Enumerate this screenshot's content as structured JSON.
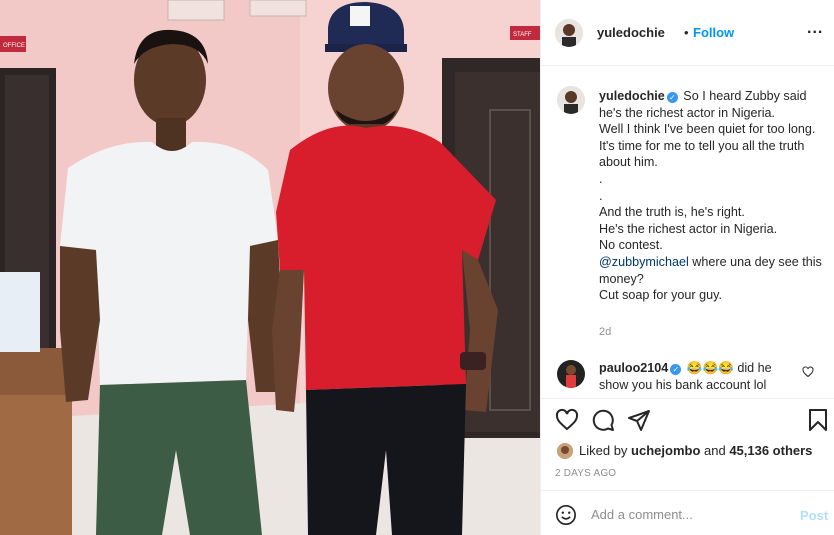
{
  "post": {
    "username": "yuledochie",
    "follow_label": "Follow",
    "dot": "•",
    "more": "...",
    "caption_lines": [
      "So I heard Zubby said he's the richest actor in Nigeria.",
      "Well I think I've been quiet for too long.",
      "It's time for me to tell you all the truth about him.",
      ".",
      ".",
      "And the truth is, he's right.",
      "He's the richest actor in Nigeria.",
      "No contest."
    ],
    "caption_mention": "@zubbymichael",
    "caption_after_mention": " where una dey see this money?",
    "caption_last": "Cut soap for your guy.",
    "caption_age": "2d"
  },
  "comment": {
    "username": "pauloo2104",
    "text": "😂😂😂 did he show you his bank account lol"
  },
  "likes": {
    "prefix": "Liked by ",
    "user": "uchejombo",
    "middle": " and ",
    "count": "45,136 others"
  },
  "posted_ago": "2 DAYS AGO",
  "add_comment": {
    "placeholder": "Add a comment...",
    "post_label": "Post"
  },
  "photo": {
    "wall_sign_left": "OFFICE",
    "wall_sign_right": "STAFF"
  },
  "colors": {
    "accent": "#0095f6",
    "verified": "#3897f0",
    "post_disabled": "#b2dffc",
    "shirt_red": "#d81e2c"
  },
  "icons": {
    "like": "heart-icon",
    "comment": "comment-icon",
    "share": "share-icon",
    "save": "bookmark-icon",
    "emoji": "emoji-icon",
    "more": "more-icon"
  }
}
